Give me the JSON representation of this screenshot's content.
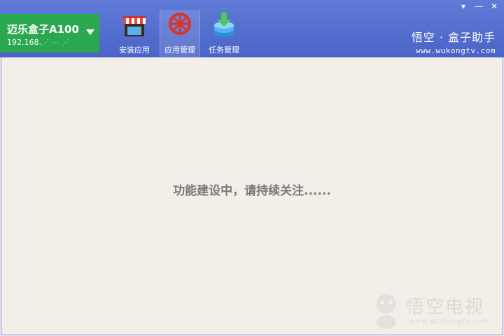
{
  "device": {
    "name": "迈乐盒子A100",
    "ip": "192.168.",
    "ip_masked": "⋰ ⋯ ⋰"
  },
  "tabs": [
    {
      "label": "安装应用",
      "icon": "store-icon",
      "active": false
    },
    {
      "label": "应用管理",
      "icon": "steering-wheel-icon",
      "active": true
    },
    {
      "label": "任务管理",
      "icon": "download-stack-icon",
      "active": false
    }
  ],
  "window_controls": {
    "menu": "▾",
    "minimize": "—",
    "close": "✕"
  },
  "brand": {
    "name": "悟空 · 盒子助手",
    "url": "www.wukongtv.com"
  },
  "content": {
    "message": "功能建设中，请持续关注......"
  },
  "watermark": {
    "name": "悟空电视",
    "url": "www.wukongtv.com"
  },
  "colors": {
    "header": "#4f6acb",
    "device_bg": "#2aa84f",
    "content_bg": "#f4eee9"
  }
}
